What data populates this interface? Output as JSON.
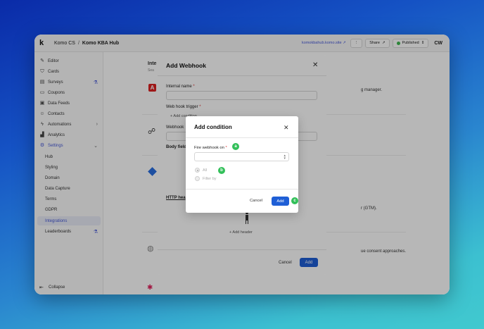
{
  "app": {
    "org": "Komo CS",
    "breadcrumb_sep": "/",
    "hub": "Komo KBA Hub",
    "site_link": "komokbahub.komo.site",
    "more": "⋮",
    "share_label": "Share",
    "status_label": "Published",
    "avatar_initials": "CW"
  },
  "sidebar": {
    "items": [
      {
        "label": "Editor",
        "icon": "edit-icon"
      },
      {
        "label": "Cards",
        "icon": "shield-icon"
      },
      {
        "label": "Surveys",
        "icon": "survey-icon",
        "badge": "flask-icon"
      },
      {
        "label": "Coupons",
        "icon": "coupon-icon"
      },
      {
        "label": "Data Feeds",
        "icon": "feed-icon"
      },
      {
        "label": "Contacts",
        "icon": "contacts-icon"
      },
      {
        "label": "Automations",
        "icon": "lightning-icon",
        "trail": "›"
      },
      {
        "label": "Analytics",
        "icon": "chart-icon"
      },
      {
        "label": "Settings",
        "icon": "gear-icon",
        "trail": "⌄"
      }
    ],
    "settings_children": [
      "Hub",
      "Styling",
      "Domain",
      "Data Capture",
      "Terms",
      "GDPR",
      "Integrations",
      "Leaderboards"
    ],
    "collapse_label": "Collapse"
  },
  "background": {
    "title_fragment": "Inte",
    "subtitle_fragment": "Sea",
    "desc1": "g manager.",
    "desc2": "r (GTM).",
    "desc3": "ue consent approaches."
  },
  "webhook_dialog": {
    "title": "Add Webhook",
    "internal_name_label": "Internal name",
    "trigger_label": "Web hook trigger",
    "add_condition_link": "+ Add condition",
    "webhook_url_label_fragment": "Webhook",
    "body_fields_label_fragment": "Body field",
    "http_headers_fragment": "HTTP hea",
    "add_header_link": "+ Add header",
    "cancel_label": "Cancel",
    "add_label": "Add",
    "required_mark": "*"
  },
  "condition_dialog": {
    "title": "Add condition",
    "fire_label": "Fire webhook on",
    "options": [
      "All",
      "Filter by"
    ],
    "cancel_label": "Cancel",
    "add_label": "Add",
    "required_mark": "*"
  },
  "markers": [
    "a",
    "b",
    "c"
  ],
  "colors": {
    "accent": "#4658d8",
    "primary_button": "#1f5fd6",
    "marker": "#33c05a",
    "published_dot": "#3fb950"
  }
}
